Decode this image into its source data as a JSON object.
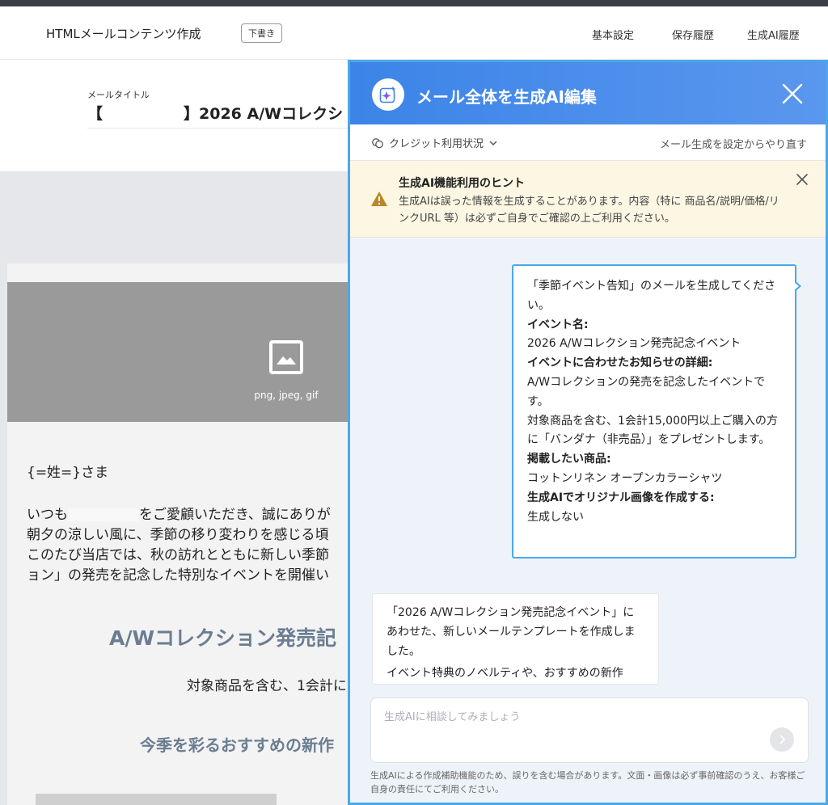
{
  "app": {
    "title": "HTMLメールコンテンツ作成",
    "badge": "下書き",
    "nav": [
      "基本設定",
      "保存履歴",
      "生成AI履歴"
    ]
  },
  "mail": {
    "title_label": "メールタイトル",
    "title_prefix": "【",
    "title_suffix": "】2026 A/Wコレクシ"
  },
  "canvas": {
    "image_caption": "png, jpeg, gif",
    "greeting": "{=姓=}さま",
    "line1_start": "いつも",
    "line1_end": "をご愛顧いただき、誠にありが",
    "line2": "朝夕の涼しい風に、季節の移り変わりを感じる頃",
    "line3": "このたび当店では、秋の訪れとともに新しい季節",
    "line4": "ョン」の発売を記念した特別なイベントを開催い",
    "heading": "A/Wコレクション発売記",
    "sub": "対象商品を含む、1会計に",
    "heading2": "今季を彩るおすすめの新作"
  },
  "ai_panel": {
    "title": "メール全体を生成AI編集",
    "credit_label": "クレジット利用状況",
    "redo_label": "メール生成を設定からやり直す",
    "hint_title": "生成AI機能利用のヒント",
    "hint_text": "生成AIは誤った情報を生成することがあります。内容（特に 商品名/説明/価格/リンクURL 等）は必ずご自身でご確認の上ご利用ください。",
    "user_message": {
      "intro": "「季節イベント告知」のメールを生成してください。",
      "event_label": "イベント名:",
      "event_value": "2026 A/Wコレクション発売記念イベント",
      "detail_label": "イベントに合わせたお知らせの詳細:",
      "detail_value_1": "A/Wコレクションの発売を記念したイベントです。",
      "detail_value_2": "対象商品を含む、1会計15,000円以上ご購入の方に「バンダナ（非売品）」をプレゼントします。",
      "product_label": "掲載したい商品:",
      "product_value": "コットンリネン オープンカラーシャツ",
      "image_label": "生成AIでオリジナル画像を作成する:",
      "image_value": "生成しない"
    },
    "ai_message": {
      "para1": "「2026 A/Wコレクション発売記念イベント」にあわせた、新しいメールテンプレートを作成しました。",
      "para2": "イベント特典のノベルティや、おすすめの新作"
    },
    "input_placeholder": "生成AIに相談してみましょう",
    "disclaimer": "生成AIによる作成補助機能のため、誤りを含む場合があります。文面・画像は必ず事前確認のうえ、お客様ご自身の責任にてご利用ください。"
  },
  "colors": {
    "accent": "#4aa8e8",
    "header_gradient_start": "#3c84e8",
    "hint_bg": "#fdf6e3",
    "warning": "#b8862b",
    "heading_text": "#6b7d91"
  }
}
